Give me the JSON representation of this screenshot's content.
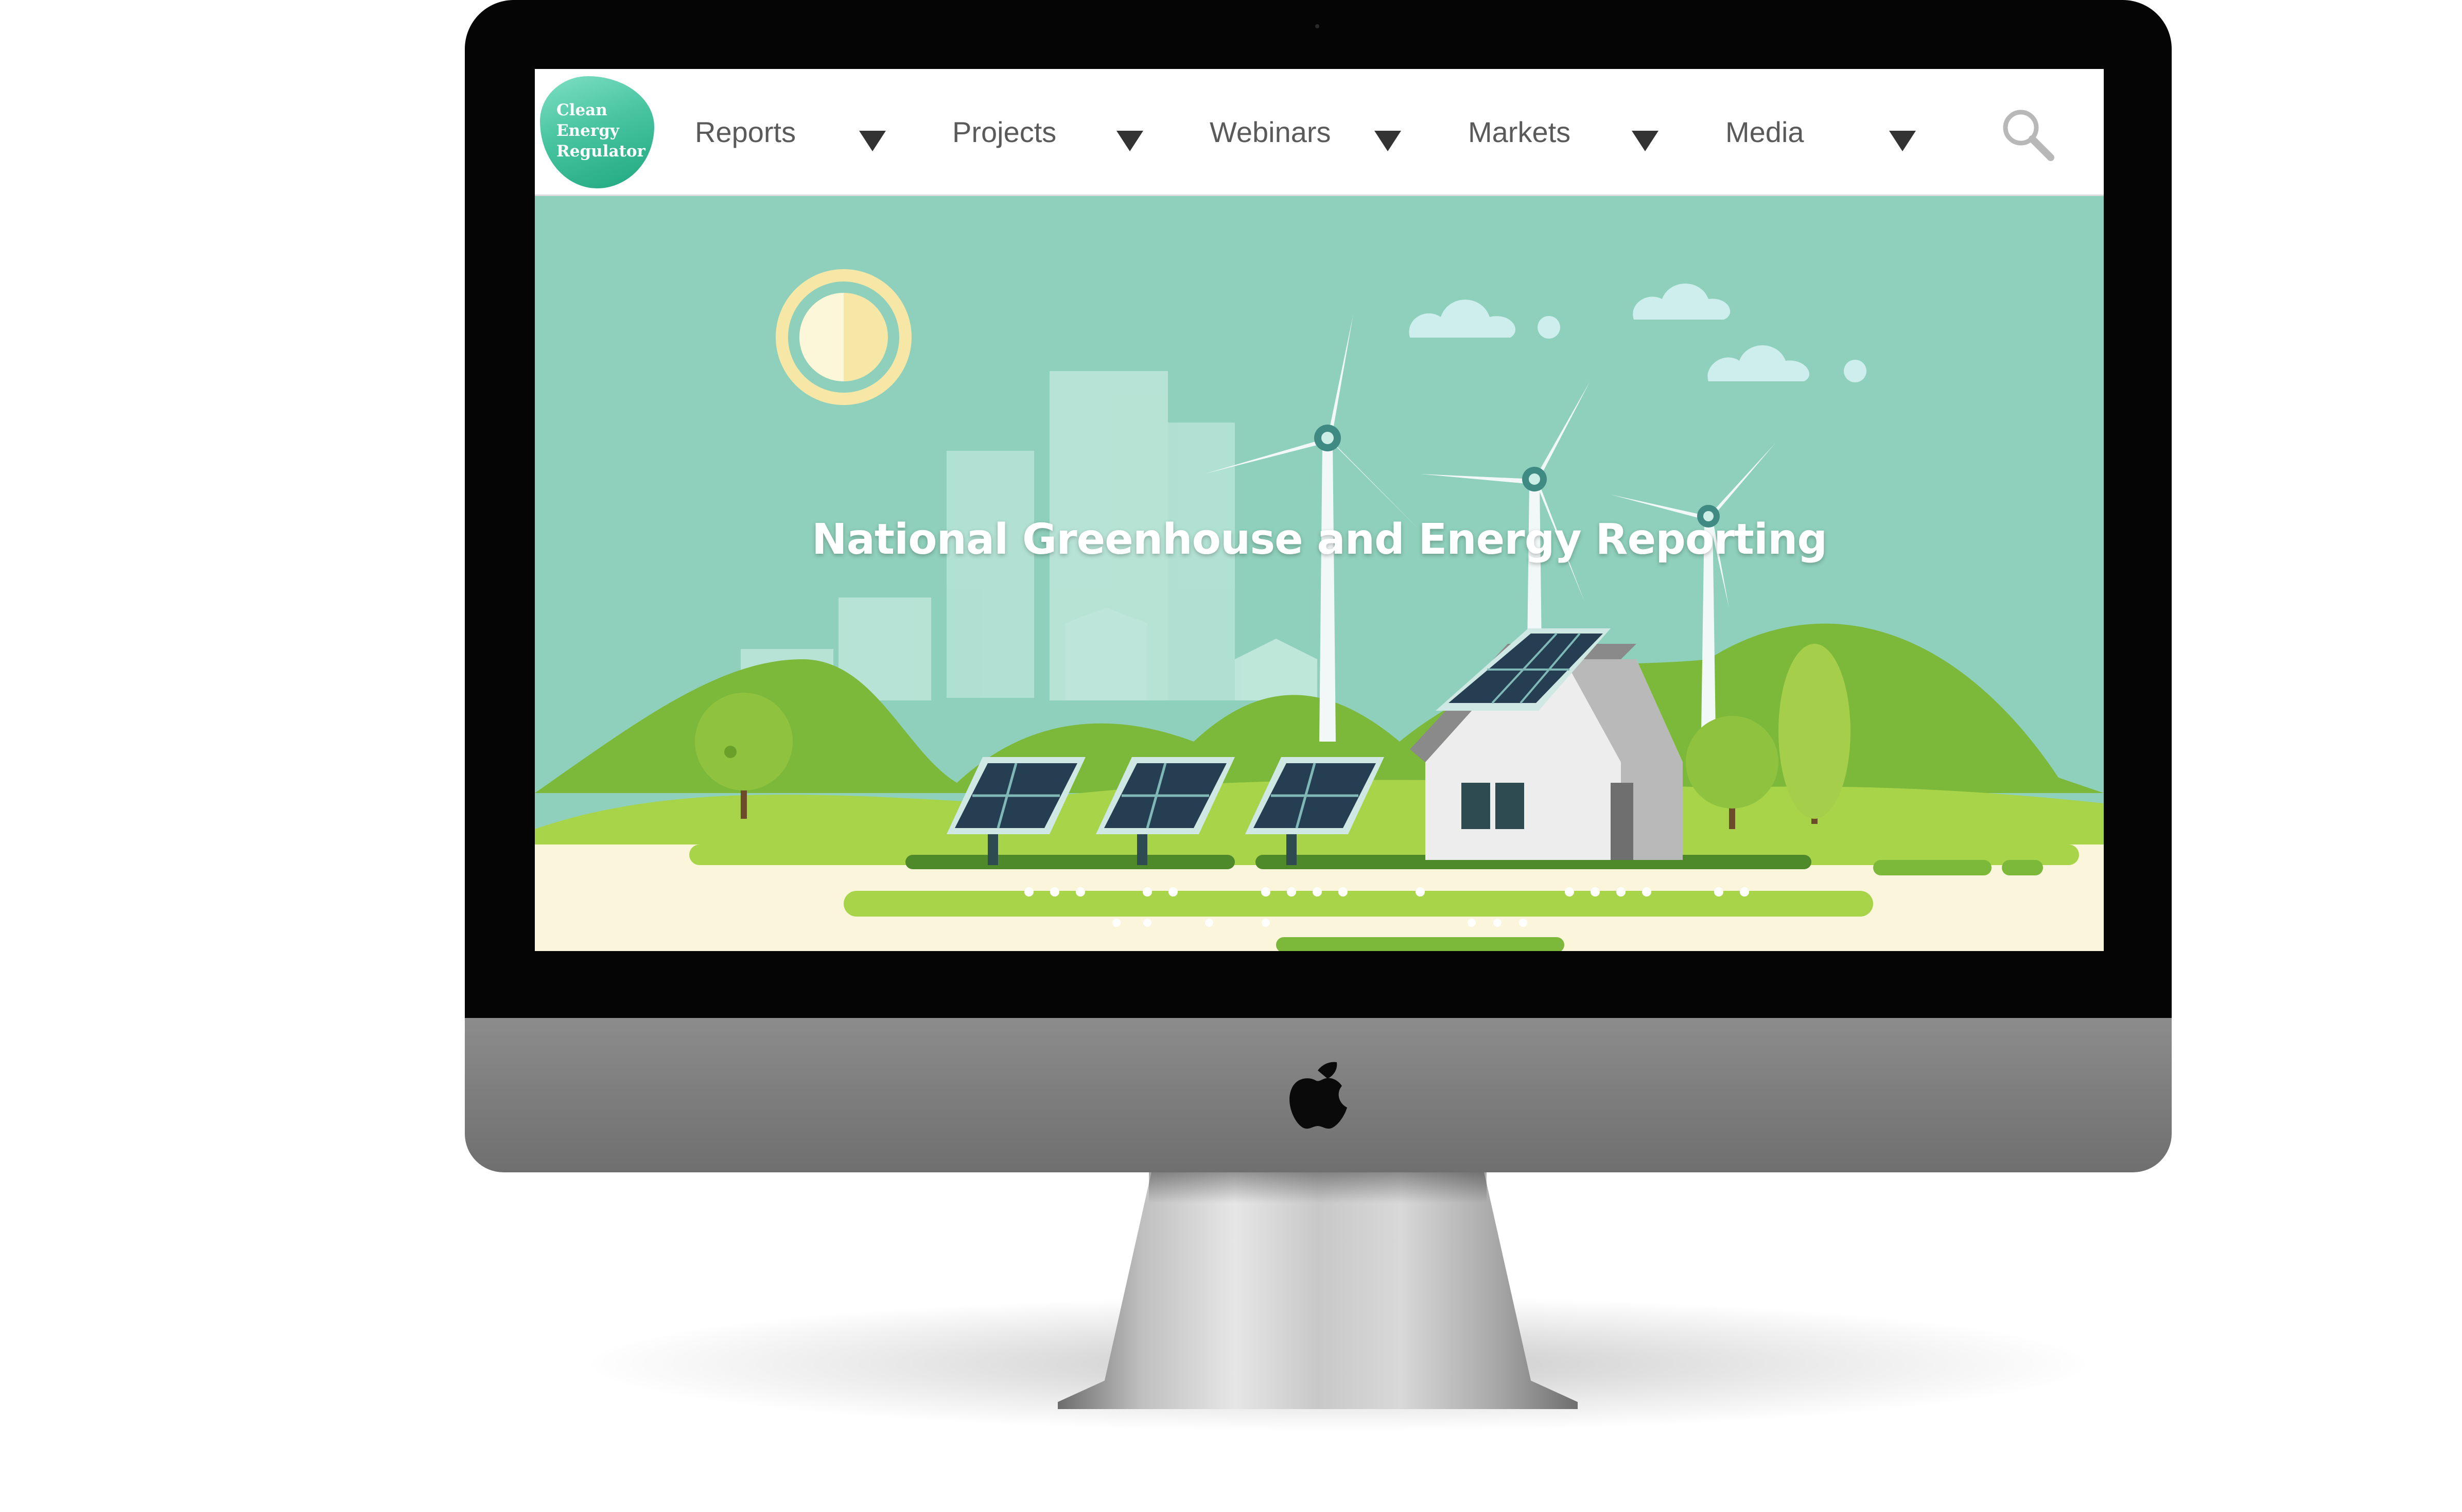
{
  "device": {
    "brand_icon": "apple-logo-icon",
    "type": "iMac"
  },
  "site": {
    "logo_lines": [
      "Clean",
      "Energy",
      "Regulator"
    ],
    "logo_color": "#3cbf9a"
  },
  "nav": {
    "items": [
      {
        "label": "Reports",
        "icon": "triangle-down-icon"
      },
      {
        "label": "Projects",
        "icon": "triangle-down-icon"
      },
      {
        "label": "Webinars",
        "icon": "triangle-down-icon"
      },
      {
        "label": "Markets",
        "icon": "triangle-down-icon"
      },
      {
        "label": "Media",
        "icon": "triangle-down-icon"
      }
    ],
    "search_icon": "search-icon"
  },
  "hero": {
    "title": "National Greenhouse and Energy Reporting",
    "background_color": "#8ed0bb",
    "illustration": [
      "sun-icon",
      "cloud-icon",
      "wind-turbine-icon",
      "solar-panel-icon",
      "house-icon",
      "tree-icon",
      "city-skyline"
    ]
  }
}
